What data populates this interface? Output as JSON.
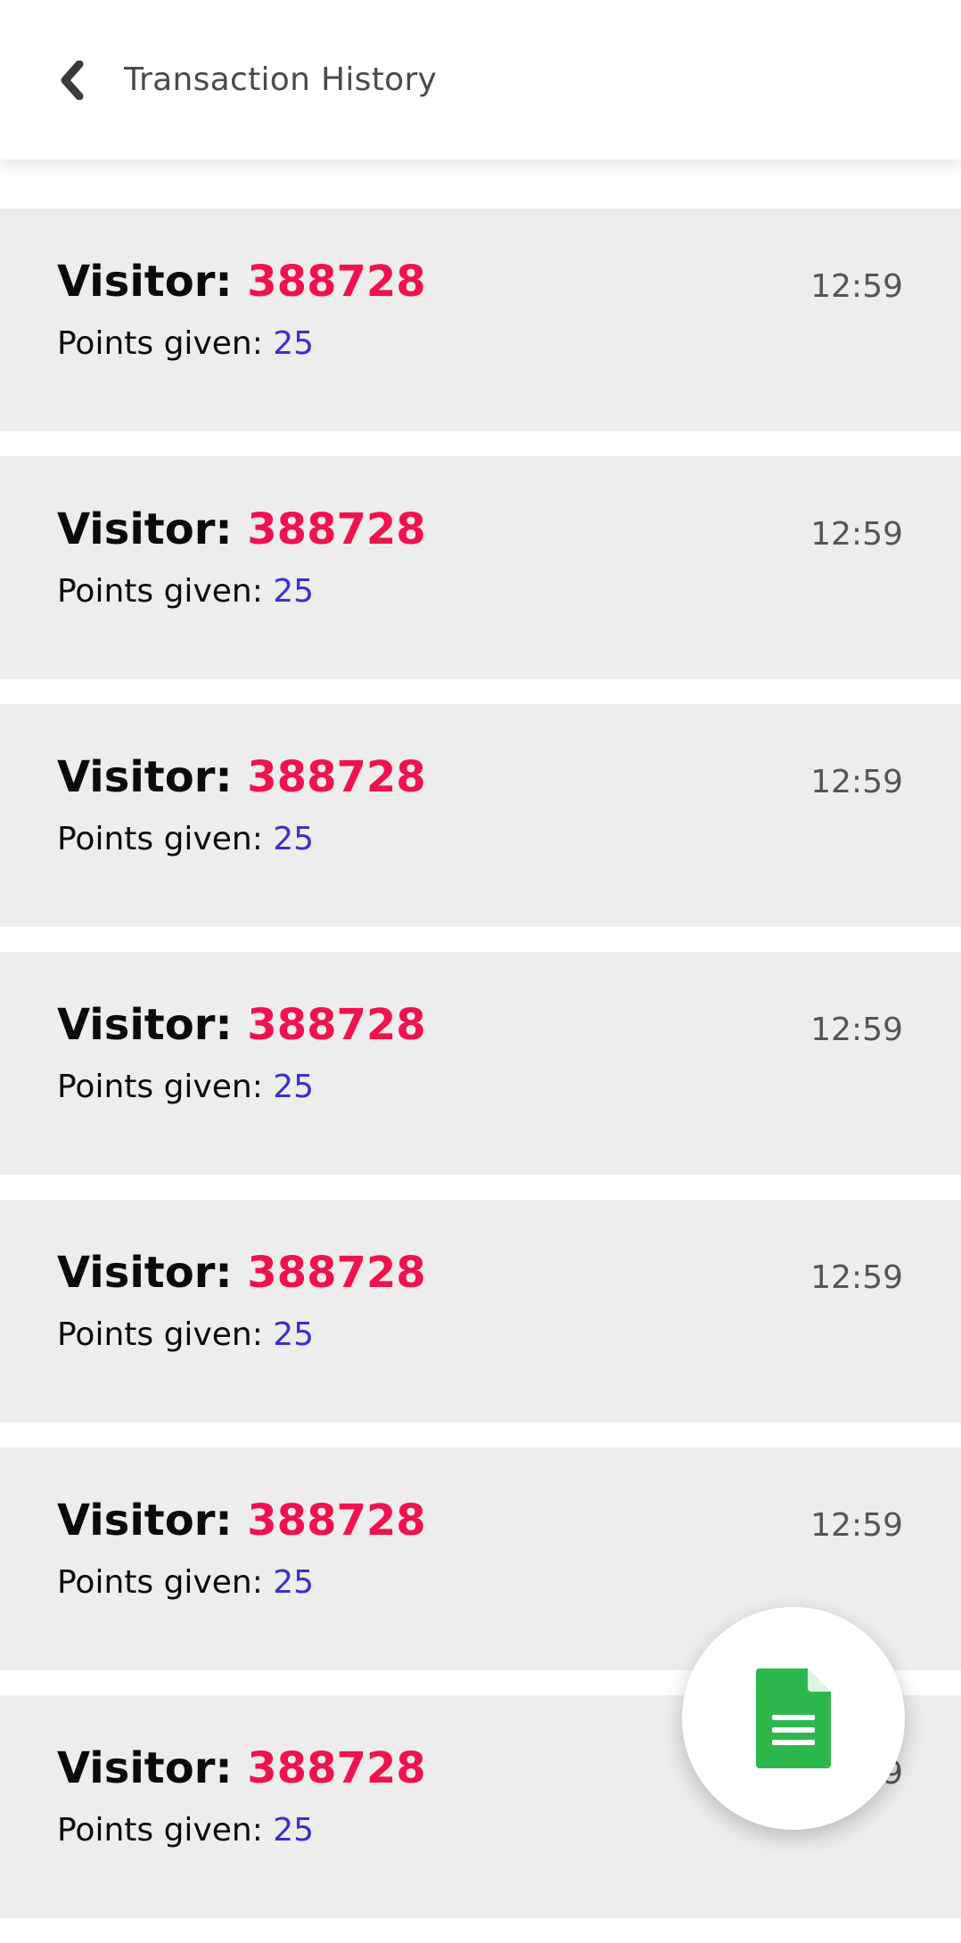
{
  "header": {
    "title": "Transaction History",
    "back_icon": "chevron-left-icon"
  },
  "labels": {
    "visitor_prefix": "Visitor: ",
    "points_prefix": "Points given: "
  },
  "transactions": [
    {
      "visitor_id": "388728",
      "points": "25",
      "time": "12:59"
    },
    {
      "visitor_id": "388728",
      "points": "25",
      "time": "12:59"
    },
    {
      "visitor_id": "388728",
      "points": "25",
      "time": "12:59"
    },
    {
      "visitor_id": "388728",
      "points": "25",
      "time": "12:59"
    },
    {
      "visitor_id": "388728",
      "points": "25",
      "time": "12:59"
    },
    {
      "visitor_id": "388728",
      "points": "25",
      "time": "12:59"
    },
    {
      "visitor_id": "388728",
      "points": "25",
      "time": "12:59"
    }
  ],
  "fab": {
    "icon": "document-icon",
    "icon_color": "#2db84d"
  },
  "colors": {
    "visitor_id": "#f0124f",
    "points_value": "#3b2fc9",
    "row_background": "#ededed"
  }
}
